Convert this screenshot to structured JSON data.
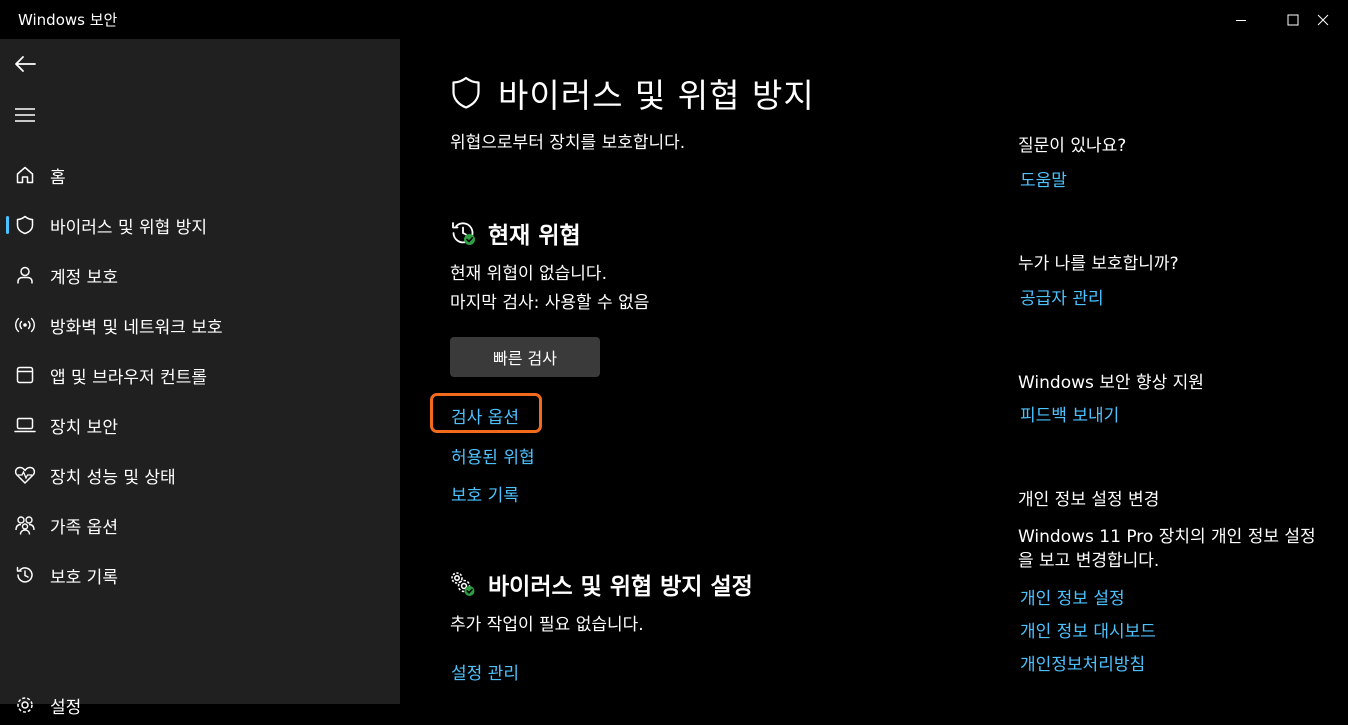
{
  "window": {
    "title": "Windows 보안"
  },
  "sidebar": {
    "items": [
      {
        "label": "홈",
        "icon": "home-icon"
      },
      {
        "label": "바이러스 및 위협 방지",
        "icon": "shield-icon",
        "active": true
      },
      {
        "label": "계정 보호",
        "icon": "person-icon"
      },
      {
        "label": "방화벽 및 네트워크 보호",
        "icon": "wireless-icon"
      },
      {
        "label": "앱 및 브라우저 컨트롤",
        "icon": "app-window-icon"
      },
      {
        "label": "장치 보안",
        "icon": "laptop-icon"
      },
      {
        "label": "장치 성능 및 상태",
        "icon": "heart-icon"
      },
      {
        "label": "가족 옵션",
        "icon": "family-icon"
      },
      {
        "label": "보호 기록",
        "icon": "history-icon"
      }
    ],
    "settings_label": "설정"
  },
  "main": {
    "title": "바이러스 및 위협 방지",
    "subtitle": "위협으로부터 장치를 보호합니다.",
    "current_threats": {
      "heading": "현재 위협",
      "status": "현재 위협이 없습니다.",
      "last_scan": "마지막 검사: 사용할 수 없음",
      "quick_scan_button": "빠른 검사",
      "links": {
        "scan_options": "검사 옵션",
        "allowed_threats": "허용된 위협",
        "protection_history": "보호 기록"
      }
    },
    "settings": {
      "heading": "바이러스 및 위협 방지 설정",
      "status": "추가 작업이 필요 없습니다.",
      "manage_link": "설정 관리"
    }
  },
  "right_panel": {
    "questions": {
      "heading": "질문이 있나요?",
      "link": "도움말"
    },
    "protector": {
      "heading": "누가 나를 보호합니까?",
      "link": "공급자 관리"
    },
    "improve": {
      "heading": "Windows 보안 향상 지원",
      "link": "피드백 보내기"
    },
    "privacy": {
      "heading": "개인 정보 설정 변경",
      "text": "Windows 11 Pro 장치의 개인 정보 설정을 보고 변경합니다.",
      "links": [
        "개인 정보 설정",
        "개인 정보 대시보드",
        "개인정보처리방침"
      ]
    }
  },
  "colors": {
    "accent_link": "#4cc2ff",
    "status_ok": "#2ea043",
    "focus_ring": "#f26b1d",
    "sidebar_bg": "#202020",
    "button_bg": "#3a3a3a"
  }
}
